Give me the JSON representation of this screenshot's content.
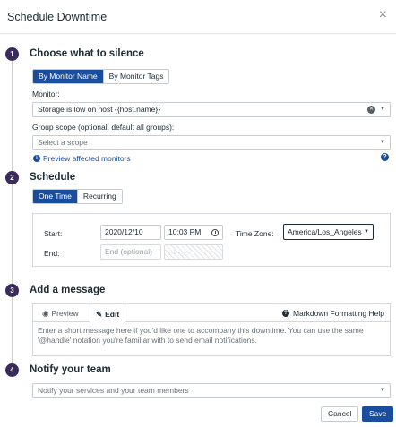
{
  "header": {
    "title": "Schedule Downtime",
    "close_symbol": "×"
  },
  "steps": [
    "1",
    "2",
    "3",
    "4"
  ],
  "section1": {
    "title": "Choose what to silence",
    "tabs": [
      "By Monitor Name",
      "By Monitor Tags"
    ],
    "monitor_label": "Monitor:",
    "monitor_value": "Storage is low on host {{host.name}}",
    "scope_label": "Group scope (optional, default all groups):",
    "scope_placeholder": "Select a scope",
    "preview_link": "Preview affected monitors"
  },
  "section2": {
    "title": "Schedule",
    "tabs": [
      "One Time",
      "Recurring"
    ],
    "start_label": "Start:",
    "start_date": "2020/12/10",
    "start_time": "10:03 PM",
    "end_label": "End:",
    "end_placeholder": "End (optional)",
    "end_time_placeholder": "--:-- --",
    "timezone_label": "Time Zone:",
    "timezone_value": "America/Los_Angeles"
  },
  "section3": {
    "title": "Add a message",
    "tab_preview": "Preview",
    "tab_edit": "Edit",
    "markdown_help": "Markdown Formatting Help",
    "placeholder": "Enter a short message here if you'd like one to accompany this downtime. You can use the same '@handle' notation you're familiar with to send email notifications."
  },
  "section4": {
    "title": "Notify your team",
    "placeholder": "Notify your services and your team members"
  },
  "footer": {
    "cancel": "Cancel",
    "save": "Save"
  },
  "colors": {
    "primary": "#1a4e9c",
    "step": "#3b2a5e",
    "text": "#1c2b34"
  }
}
